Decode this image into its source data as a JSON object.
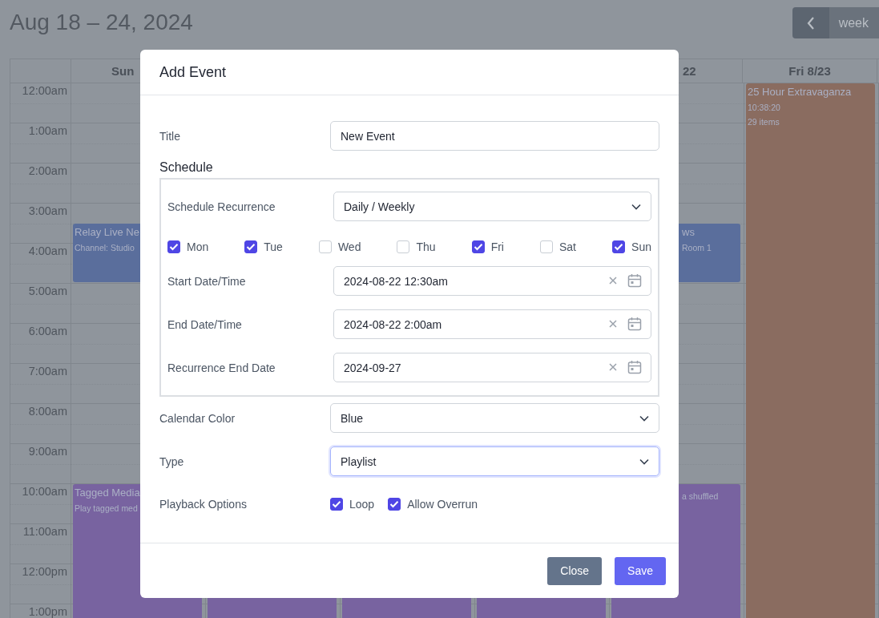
{
  "header": {
    "title": "Aug 18 – 24, 2024",
    "view_button": "week"
  },
  "calendar": {
    "times": [
      "12:00am",
      "1:00am",
      "2:00am",
      "3:00am",
      "4:00am",
      "5:00am",
      "6:00am",
      "7:00am",
      "8:00am",
      "9:00am",
      "10:00am",
      "11:00am",
      "12:00pm",
      "1:00pm"
    ],
    "columns": [
      {
        "label": "Sun",
        "events": [
          {
            "title": "Relay Live Ne",
            "lines": [
              "Channel: Studio"
            ],
            "color": "#5a6e9c"
          },
          {
            "title": "Tagged Media",
            "lines": [
              "Play tagged med"
            ],
            "color": "#7863a0"
          }
        ]
      },
      {
        "events": [
          {
            "color": "#7863a0"
          }
        ]
      },
      {
        "events": [
          {
            "color": "#7863a0"
          }
        ]
      },
      {
        "events": [
          {
            "color": "#7863a0"
          }
        ]
      },
      {
        "label": "22",
        "events": [
          {
            "title": "ws",
            "lines": [
              "Room 1"
            ],
            "color": "#5a6e9c"
          },
          {
            "lines": [
              "a shuffled"
            ],
            "color": "#7863a0"
          }
        ]
      },
      {
        "label": "Fri 8/23",
        "events": [
          {
            "title": "25 Hour Extravaganza",
            "lines": [
              "10:38:20",
              "29 items"
            ],
            "color": "#8a6c60"
          }
        ]
      }
    ]
  },
  "modal": {
    "title": "Add Event",
    "title_field": {
      "label": "Title",
      "value": "New Event"
    },
    "schedule": {
      "heading": "Schedule",
      "recurrence": {
        "label": "Schedule Recurrence",
        "value": "Daily / Weekly"
      },
      "days": [
        {
          "label": "Mon",
          "checked": true
        },
        {
          "label": "Tue",
          "checked": true
        },
        {
          "label": "Wed",
          "checked": false
        },
        {
          "label": "Thu",
          "checked": false
        },
        {
          "label": "Fri",
          "checked": true
        },
        {
          "label": "Sat",
          "checked": false
        },
        {
          "label": "Sun",
          "checked": true
        }
      ],
      "dates": [
        {
          "label": "Start Date/Time",
          "value": "2024-08-22 12:30am"
        },
        {
          "label": "End Date/Time",
          "value": "2024-08-22 2:00am"
        },
        {
          "label": "Recurrence End Date",
          "value": "2024-09-27"
        }
      ]
    },
    "selects": [
      {
        "label": "Calendar Color",
        "value": "Blue",
        "focused": false
      },
      {
        "label": "Type",
        "value": "Playlist",
        "focused": true
      }
    ],
    "playback": {
      "label": "Playback Options",
      "options": [
        {
          "label": "Loop",
          "checked": true
        },
        {
          "label": "Allow Overrun",
          "checked": true
        }
      ]
    },
    "buttons": [
      {
        "label": "Close",
        "kind": "secondary"
      },
      {
        "label": "Save",
        "kind": "primary"
      }
    ]
  }
}
